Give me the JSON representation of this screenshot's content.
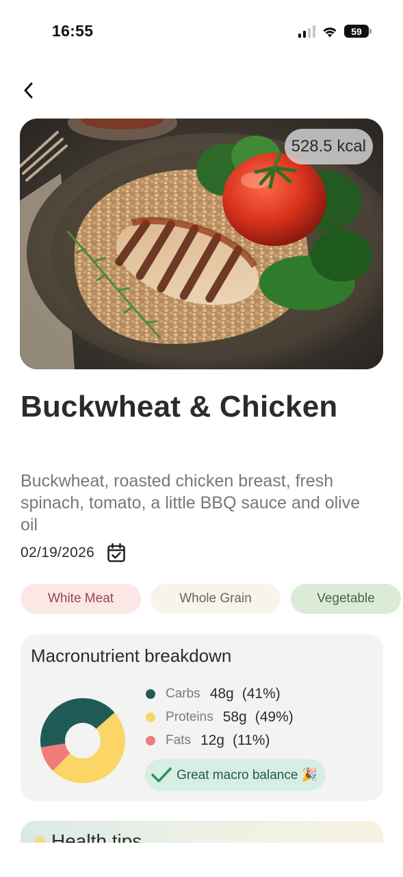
{
  "status_bar": {
    "time": "16:55",
    "battery": "59",
    "icons": [
      "signal-icon",
      "wifi-icon",
      "battery-icon"
    ]
  },
  "nav": {
    "back_icon": "chevron-left-icon"
  },
  "dish": {
    "kcal": "528.5 kcal",
    "title": "Buckwheat & Chicken",
    "description": "Buckwheat, roasted chicken breast, fresh spinach, tomato, a little BBQ sauce and olive oil",
    "date": "02/19/2026",
    "date_icon": "calendar-check-icon"
  },
  "tags": [
    {
      "label": "White Meat",
      "color": "#fbe7e6"
    },
    {
      "label": "Whole Grain",
      "color": "#f8f4ec"
    },
    {
      "label": "Vegetable",
      "color": "#dcebd8"
    }
  ],
  "macros": {
    "title": "Macronutrient breakdown",
    "items": [
      {
        "name": "Carbs",
        "grams": "48g",
        "percent": "(41%)",
        "fraction": 0.41,
        "color": "#1f5c57"
      },
      {
        "name": "Proteins",
        "grams": "58g",
        "percent": "(49%)",
        "fraction": 0.49,
        "color": "#fbd666"
      },
      {
        "name": "Fats",
        "grams": "12g",
        "percent": "(11%)",
        "fraction": 0.1,
        "color": "#f27c7c"
      }
    ],
    "balance_label": "Great macro balance 🎉",
    "balance_icon": "checkmark-icon"
  },
  "health_tips": {
    "title": "Health tips"
  },
  "colors": {
    "accent_green": "#1f5c57",
    "pill_bg": "#d6eee4"
  }
}
